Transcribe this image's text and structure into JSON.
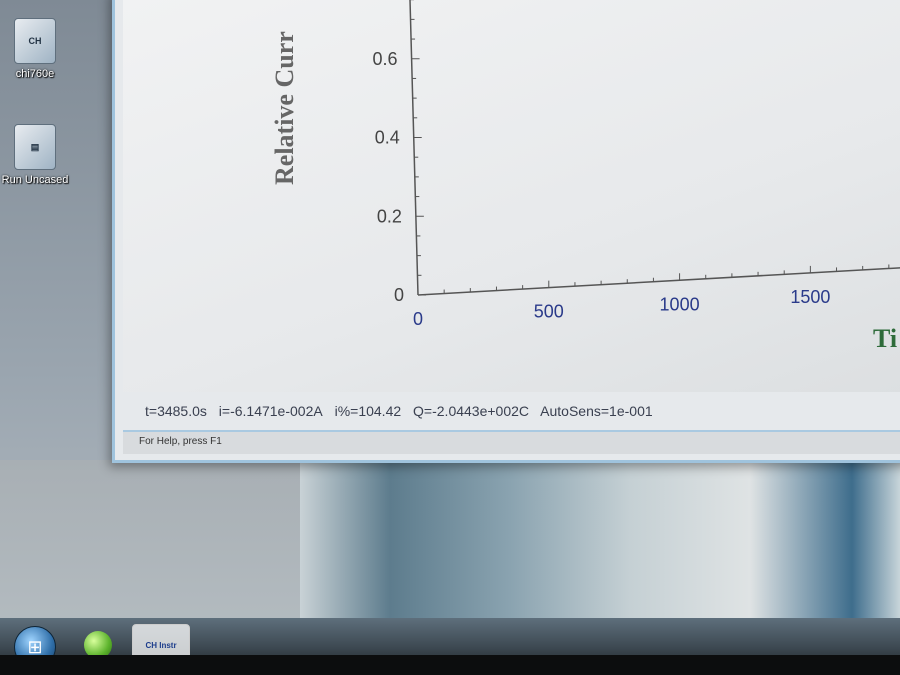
{
  "desktop": {
    "icons": [
      {
        "label": "chi760e",
        "glyph": "CH"
      },
      {
        "label": "Run Uncased",
        "glyph": "▤"
      }
    ]
  },
  "window": {
    "status": {
      "t": "t=3485.0s",
      "i": "i=-6.1471e-002A",
      "i_pct": "i%=104.42",
      "q": "Q=-2.0443e+002C",
      "autosens": "AutoSens=1e-001"
    },
    "help_text": "For Help, press F1"
  },
  "taskbar": {
    "start_glyph": "⊞",
    "chi_label": "CH Instr"
  },
  "chart_data": {
    "type": "line",
    "ylabel": "Relative Curr",
    "xlabel": "Ti",
    "x_ticks": [
      "0",
      "500",
      "1000",
      "1500"
    ],
    "y_ticks": [
      "0",
      "0.2",
      "0.4",
      "0.6"
    ],
    "ylim": [
      0,
      0.8
    ],
    "xlim": [
      0,
      1900
    ],
    "series": []
  }
}
